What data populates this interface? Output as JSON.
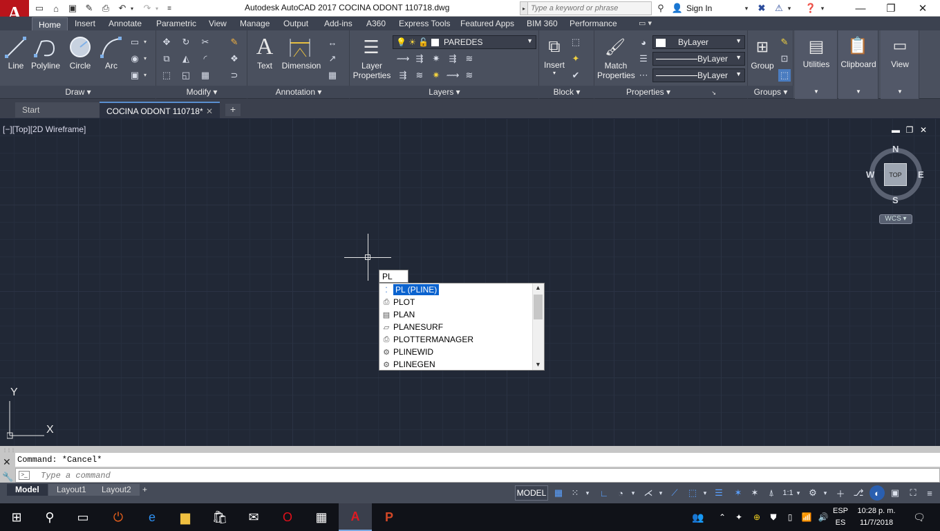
{
  "window": {
    "title": "Autodesk AutoCAD 2017    COCINA ODONT 110718.dwg",
    "search_placeholder": "Type a keyword or phrase",
    "sign_in": "Sign In",
    "app_letter": "A"
  },
  "ribbon_tabs": [
    "Home",
    "Insert",
    "Annotate",
    "Parametric",
    "View",
    "Manage",
    "Output",
    "Add-ins",
    "A360",
    "Express Tools",
    "Featured Apps",
    "BIM 360",
    "Performance"
  ],
  "draw": {
    "title": "Draw",
    "line": "Line",
    "polyline": "Polyline",
    "circle": "Circle",
    "arc": "Arc"
  },
  "modify": {
    "title": "Modify"
  },
  "annotation": {
    "title": "Annotation",
    "text": "Text",
    "dimension": "Dimension"
  },
  "layers": {
    "title": "Layers",
    "layer_properties_1": "Layer",
    "layer_properties_2": "Properties",
    "current_layer": "PAREDES"
  },
  "block": {
    "title": "Block",
    "insert": "Insert"
  },
  "properties": {
    "title": "Properties",
    "match_1": "Match",
    "match_2": "Properties",
    "color": "ByLayer",
    "linetype": "ByLayer",
    "lineweight": "ByLayer"
  },
  "groups": {
    "title": "Groups",
    "group": "Group"
  },
  "utilities": {
    "label": "Utilities"
  },
  "clipboard": {
    "label": "Clipboard"
  },
  "view_panel": {
    "label": "View"
  },
  "file_tabs": {
    "start": "Start",
    "doc": "COCINA ODONT 110718*"
  },
  "viewport": {
    "label": "[−][Top][2D Wireframe]",
    "compass": {
      "n": "N",
      "s": "S",
      "e": "E",
      "w": "W",
      "top": "TOP"
    },
    "wcs": "WCS",
    "ucs_x": "X",
    "ucs_y": "Y",
    "dynamic_input": "PL"
  },
  "autocomplete": [
    {
      "label": "PL (PLINE)",
      "icon": "dots-icon",
      "selected": true
    },
    {
      "label": "PLOT",
      "icon": "printer-icon",
      "selected": false
    },
    {
      "label": "PLAN",
      "icon": "plan-icon",
      "selected": false
    },
    {
      "label": "PLANESURF",
      "icon": "plane-surface-icon",
      "selected": false
    },
    {
      "label": "PLOTTERMANAGER",
      "icon": "printer-icon",
      "selected": false
    },
    {
      "label": "PLINEWID",
      "icon": "gear-icon",
      "selected": false
    },
    {
      "label": "PLINEGEN",
      "icon": "gear-icon",
      "selected": false
    }
  ],
  "command": {
    "history": "Command: *Cancel*",
    "placeholder": "Type a command"
  },
  "layout_tabs": [
    "Model",
    "Layout1",
    "Layout2"
  ],
  "status": {
    "model": "MODEL",
    "scale": "1:1"
  },
  "taskbar": {
    "lang_1": "ESP",
    "lang_2": "ES",
    "time": "10:28 p. m.",
    "date": "11/7/2018"
  },
  "colors": {
    "accent": "#b9141b",
    "selection": "#0b63cf",
    "canvas": "#212836",
    "ribbon": "#4a505e"
  }
}
